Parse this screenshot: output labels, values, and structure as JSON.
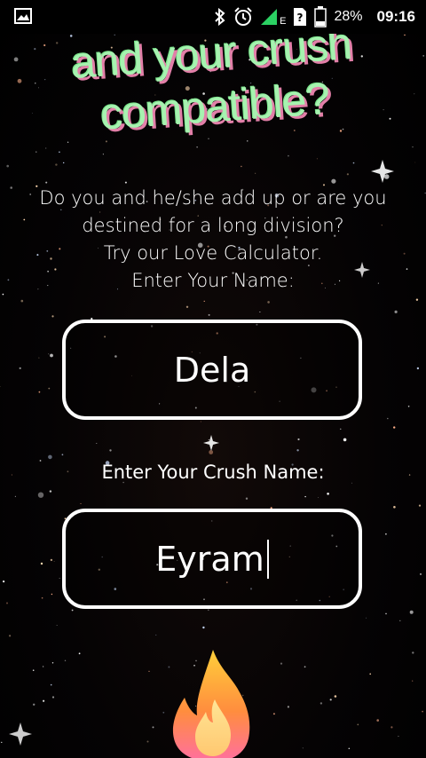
{
  "status_bar": {
    "battery_percent": "28%",
    "time": "09:16",
    "network_label": "E",
    "icons": [
      "image-icon",
      "bluetooth-icon",
      "alarm-icon",
      "signal-icon",
      "sim-unknown-icon",
      "battery-icon"
    ]
  },
  "headline": {
    "line1": "and your crush",
    "line2": "compatible?"
  },
  "intro": {
    "line1": "Do you and he/she add up or are you",
    "line2": "destined for a long division?",
    "line3": "Try our Love Calculator.",
    "line4": "Enter Your Name:"
  },
  "name_field": {
    "value": "Dela"
  },
  "crush_field": {
    "label": "Enter Your Crush Name:",
    "value": "Eyram"
  },
  "colors": {
    "headline_fill": "#a7f2b0",
    "headline_shadow": "#e27fa8",
    "text": "#ffffff",
    "background": "#000000"
  },
  "decoration": {
    "flame": "fire-icon"
  }
}
